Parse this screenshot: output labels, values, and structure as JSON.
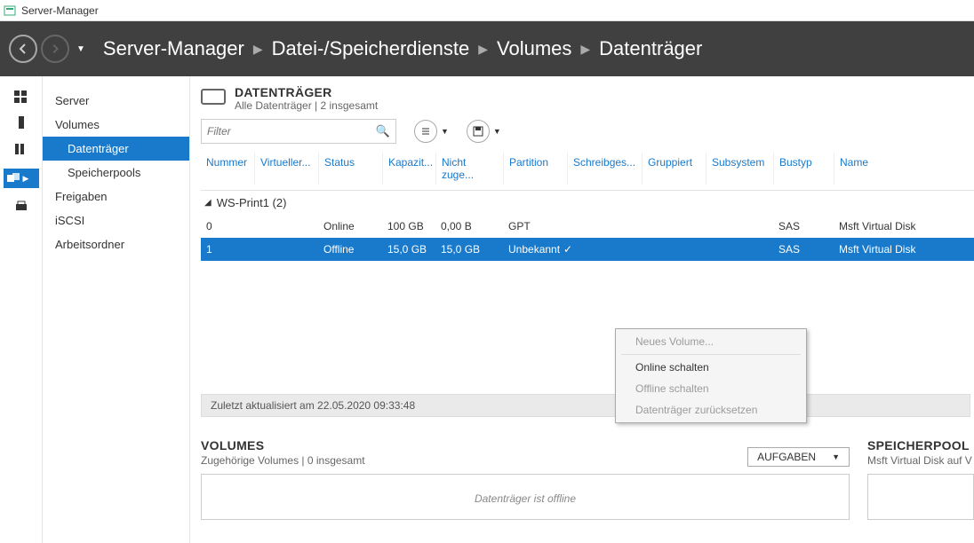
{
  "window": {
    "title": "Server-Manager"
  },
  "breadcrumb": [
    "Server-Manager",
    "Datei-/Speicherdienste",
    "Volumes",
    "Datenträger"
  ],
  "sidebar": {
    "items": [
      {
        "label": "Server",
        "sub": false
      },
      {
        "label": "Volumes",
        "sub": false
      },
      {
        "label": "Datenträger",
        "sub": true,
        "selected": true
      },
      {
        "label": "Speicherpools",
        "sub": true
      },
      {
        "label": "Freigaben",
        "sub": false
      },
      {
        "label": "iSCSI",
        "sub": false
      },
      {
        "label": "Arbeitsordner",
        "sub": false
      }
    ]
  },
  "section": {
    "title": "DATENTRÄGER",
    "subtitle": "Alle Datenträger | 2 insgesamt"
  },
  "filter": {
    "placeholder": "Filter"
  },
  "columns": {
    "number": "Nummer",
    "virtual": "Virtueller...",
    "status": "Status",
    "capacity": "Kapazit...",
    "unallocated": "Nicht zuge...",
    "partition": "Partition",
    "readonly": "Schreibges...",
    "grouped": "Gruppiert",
    "subsystem": "Subsystem",
    "bustype": "Bustyp",
    "name": "Name"
  },
  "group": {
    "label": "WS-Print1 (2)"
  },
  "rows": [
    {
      "number": "0",
      "status": "Online",
      "capacity": "100 GB",
      "unallocated": "0,00 B",
      "partition": "GPT",
      "bustype": "SAS",
      "name": "Msft Virtual Disk",
      "selected": false
    },
    {
      "number": "1",
      "status": "Offline",
      "capacity": "15,0 GB",
      "unallocated": "15,0 GB",
      "partition": "Unbekannt",
      "bustype": "SAS",
      "name": "Msft Virtual Disk",
      "selected": true
    }
  ],
  "context_menu": {
    "items": [
      {
        "label": "Neues Volume...",
        "enabled": false
      },
      {
        "label": "Online schalten",
        "enabled": true
      },
      {
        "label": "Offline schalten",
        "enabled": false
      },
      {
        "label": "Datenträger zurücksetzen",
        "enabled": false
      }
    ]
  },
  "status_bar": "Zuletzt aktualisiert am 22.05.2020 09:33:48",
  "volumes_panel": {
    "title": "VOLUMES",
    "subtitle": "Zugehörige Volumes | 0 insgesamt",
    "tasks_label": "AUFGABEN",
    "body": "Datenträger ist offline"
  },
  "pool_panel": {
    "title": "SPEICHERPOOL",
    "subtitle": "Msft Virtual Disk auf V"
  }
}
